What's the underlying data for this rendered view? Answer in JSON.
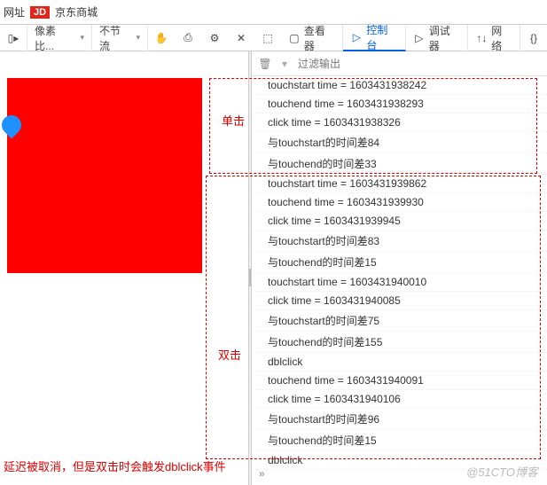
{
  "topbar": {
    "address_label": "网址",
    "jd_badge": "JD",
    "jd_text": "京东商城"
  },
  "toolbar": {
    "pick_label": "",
    "pixel_label": "像素比...",
    "throttle_label": "不节流",
    "inspector": "查看器",
    "console": "控制台",
    "debugger": "调试器",
    "network": "网络"
  },
  "filter": {
    "placeholder": "过滤输出"
  },
  "logs": [
    "touchstart time = 1603431938242",
    "touchend time = 1603431938293",
    "click time = 1603431938326",
    "与touchstart的时间差84",
    "与touchend的时间差33",
    "touchstart time = 1603431939862",
    "touchend time = 1603431939930",
    "click time = 1603431939945",
    "与touchstart的时间差83",
    "与touchend的时间差15",
    "touchstart time = 1603431940010",
    "click time = 1603431940085",
    "与touchstart的时间差75",
    "与touchend的时间差155",
    "dblclick",
    "touchend time = 1603431940091",
    "click time = 1603431940106",
    "与touchstart的时间差96",
    "与touchend的时间差15",
    "dblclick"
  ],
  "annotations": {
    "single": "单击",
    "double": "双击",
    "footer": "延迟被取消，但是双击时会触发dblclick事件"
  },
  "watermark": "@51CTO博客",
  "chevron": "»"
}
